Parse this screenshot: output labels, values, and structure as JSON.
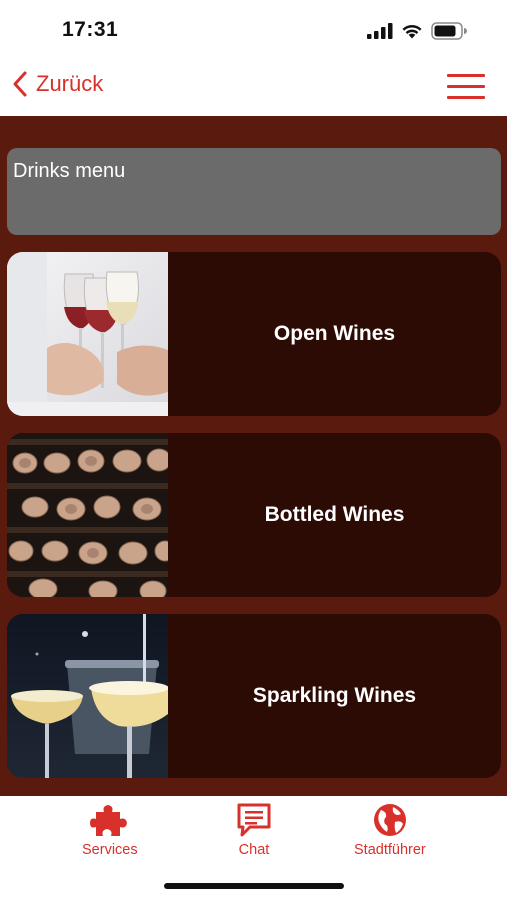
{
  "status_bar": {
    "time": "17:31",
    "icons": [
      "cellular-signal-icon",
      "wifi-icon",
      "battery-icon"
    ]
  },
  "nav": {
    "back_label": "Zurück",
    "menu_icon": "hamburger-menu-icon"
  },
  "colors": {
    "accent": "#d8312c",
    "content_background": "#5a1a0e",
    "card_background": "#2d0b05",
    "title_box_background": "#6b6b6b"
  },
  "section_title": "Drinks menu",
  "menu_items": [
    {
      "label": "Open Wines",
      "image": "wine-glasses-toast-photo"
    },
    {
      "label": "Bottled Wines",
      "image": "wine-bottles-rack-photo"
    },
    {
      "label": "Sparkling Wines",
      "image": "champagne-glasses-photo"
    }
  ],
  "tab_bar": {
    "items": [
      {
        "label": "Services",
        "icon": "puzzle-piece-icon"
      },
      {
        "label": "Chat",
        "icon": "chat-bubble-icon"
      },
      {
        "label": "Stadtführer",
        "icon": "globe-icon"
      }
    ]
  }
}
